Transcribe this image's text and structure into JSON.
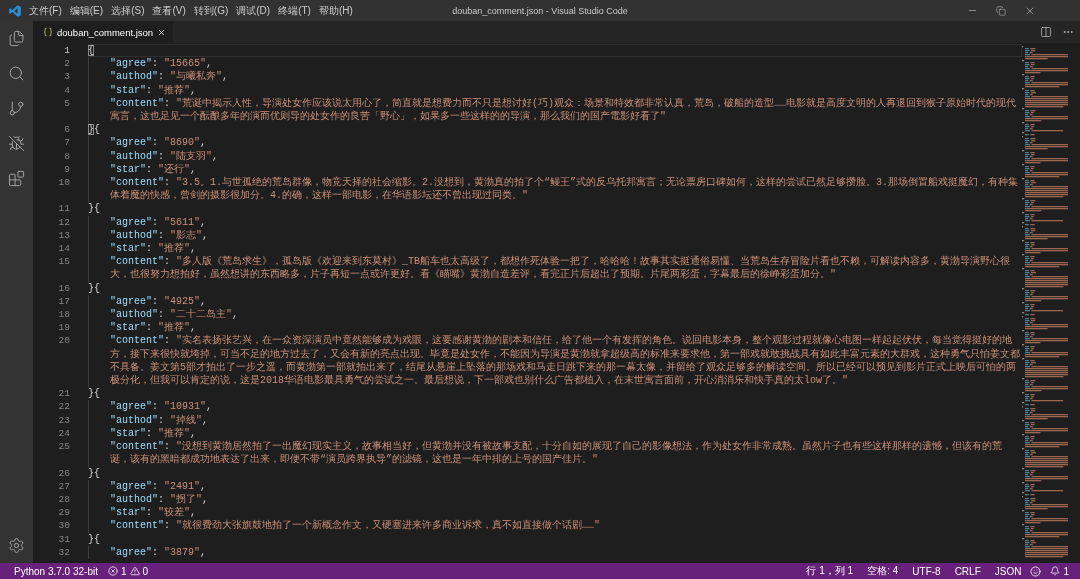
{
  "window": {
    "title": "douban_comment.json - Visual Studio Code"
  },
  "menu": [
    "文件(F)",
    "编辑(E)",
    "选择(S)",
    "查看(V)",
    "转到(G)",
    "调试(D)",
    "终端(T)",
    "帮助(H)"
  ],
  "tabs": [
    {
      "label": "douban_comment.json",
      "selected": true
    }
  ],
  "editor": {
    "lines": [
      {
        "number": "1",
        "kind": "bracket",
        "text": "{",
        "current": true,
        "bracket_match": true
      },
      {
        "number": "2",
        "kind": "field",
        "text": "\"agree\": \"15665\",",
        "current": false,
        "bracket_match": false
      },
      {
        "number": "3",
        "kind": "field",
        "text": "\"authod\": \"与曦私奔\",",
        "current": false,
        "bracket_match": false
      },
      {
        "number": "4",
        "kind": "field",
        "text": "\"star\": \"推荐\",",
        "current": false,
        "bracket_match": false
      },
      {
        "number": "5",
        "kind": "field",
        "text": "\"content\": \"荒诞中揭示人性，导演处女作应该说太用心了，简直就是想费力而不只是想讨好(巧)观众：场景和特效都非常认真，荒岛，破船的造型……电影就是高度文明的人再退回到猴子原始时代的现代寓言，这也足见一个酝酿多年的演而优则导的处女作的良苦「野心」，如果多一些这样的的导演，那么我们的国产電影好看了\"",
        "current": false,
        "bracket_match": false
      },
      {
        "number": "6",
        "kind": "bracket",
        "text": "}{",
        "current": false,
        "bracket_match": true
      },
      {
        "number": "7",
        "kind": "field",
        "text": "\"agree\": \"8690\",",
        "current": false,
        "bracket_match": false
      },
      {
        "number": "8",
        "kind": "field",
        "text": "\"authod\": \"陆支羽\",",
        "current": false,
        "bracket_match": false
      },
      {
        "number": "9",
        "kind": "field",
        "text": "\"star\": \"还行\",",
        "current": false,
        "bracket_match": false
      },
      {
        "number": "10",
        "kind": "field",
        "text": "\"content\": \"3.5。1.与世孤绝的荒岛群像，物竞天择的社会缩影。2.没想到，黄渤真的拍了个“鳗王”式的反乌托邦寓言；无论票房口碑如何，这样的尝试已然足够攒脸。3.那场倒置船戏挺魔幻，有种集体着魔的快感，曾剑的摄影很加分。4.的确，这样一部电影，在华语影坛还不曾出现过同类。\"",
        "current": false,
        "bracket_match": false
      },
      {
        "number": "11",
        "kind": "bracket",
        "text": "}{",
        "current": false,
        "bracket_match": false
      },
      {
        "number": "12",
        "kind": "field",
        "text": "\"agree\": \"5611\",",
        "current": false,
        "bracket_match": false
      },
      {
        "number": "13",
        "kind": "field",
        "text": "\"authod\": \"影志\",",
        "current": false,
        "bracket_match": false
      },
      {
        "number": "14",
        "kind": "field",
        "text": "\"star\": \"推荐\",",
        "current": false,
        "bracket_match": false
      },
      {
        "number": "15",
        "kind": "field",
        "text": "\"content\": \"多人版《荒岛求生》，孤岛版《欢迎来到东莫村》_TB船车也太高级了，都想作死体验一把了，哈哈哈！故事其实挺通俗易懂、当荒岛生存冒险片看也不赖，可解读内容多，黄渤导演野心很大，也很努力想拍好，虽然想讲的东西略多，片子再短一点或许更好。看《瞄嘴》黄渤自造差评，看完正片后超出了预期。片尾两彩蛋，字幕最后的徐峥彩蛋加分。\"",
        "current": false,
        "bracket_match": false
      },
      {
        "number": "16",
        "kind": "bracket",
        "text": "}{",
        "current": false,
        "bracket_match": false
      },
      {
        "number": "17",
        "kind": "field",
        "text": "\"agree\": \"4925\",",
        "current": false,
        "bracket_match": false
      },
      {
        "number": "18",
        "kind": "field",
        "text": "\"authod\": \"二十二岛主\",",
        "current": false,
        "bracket_match": false
      },
      {
        "number": "19",
        "kind": "field",
        "text": "\"star\": \"推荐\",",
        "current": false,
        "bracket_match": false
      },
      {
        "number": "20",
        "kind": "field",
        "text": "\"content\": \"实名表扬张艺兴，在一众资深演员中竟然能够成为戏眼，这要感谢黄渤的剧本和信任，给了他一个有发挥的角色。说回电影本身，整个观影过程就像心电图一样起起伏伏，每当觉得挺好的地方，接下来很快就垮掉，可当不足的地方过去了，又会有新的亮点出现。毕竟是处女作，不能因为导演是黄渤就拿超级高的标准来要求他，第一部戏就敢挑战具有如此丰富元素的大群戏，这种勇气只怕姜文都不具备。姜文第5部才拍出了一步之遥，而黄渤第一部就拍出来了，结尾从悬崖上坠落的那场戏和马走日跳下来的那一幕太像，并留给了观众足够多的解读空间。所以已经可以预见到影片正式上映后可怕的两极分化，但我可以肯定的说，这是2018华语电影最具勇气的尝试之一。最后想说，下一部戏也别什么广告都植入，在末世寓言面前，开心消消乐和快手真的太low了。\"",
        "current": false,
        "bracket_match": false
      },
      {
        "number": "21",
        "kind": "bracket",
        "text": "}{",
        "current": false,
        "bracket_match": false
      },
      {
        "number": "22",
        "kind": "field",
        "text": "\"agree\": \"10931\",",
        "current": false,
        "bracket_match": false
      },
      {
        "number": "23",
        "kind": "field",
        "text": "\"authod\": \"掉线\",",
        "current": false,
        "bracket_match": false
      },
      {
        "number": "24",
        "kind": "field",
        "text": "\"star\": \"推荐\",",
        "current": false,
        "bracket_match": false
      },
      {
        "number": "25",
        "kind": "field",
        "text": "\"content\": \"没想到黄渤居然拍了一出魔幻现实主义，故事相当好，但黄渤并没有被故事支配，十分自如的展现了自己的影像想法，作为处女作非常成熟。虽然片子也有些这样那样的遗憾，但该有的荒诞，该有的黑暗都成功地表达了出来，即便不带“演员跨界执导”的滤镜，这也是一年中排的上号的国产佳片。\"",
        "current": false,
        "bracket_match": false
      },
      {
        "number": "26",
        "kind": "bracket",
        "text": "}{",
        "current": false,
        "bracket_match": false
      },
      {
        "number": "27",
        "kind": "field",
        "text": "\"agree\": \"2491\",",
        "current": false,
        "bracket_match": false
      },
      {
        "number": "28",
        "kind": "field",
        "text": "\"authod\": \"拐了\",",
        "current": false,
        "bracket_match": false
      },
      {
        "number": "29",
        "kind": "field",
        "text": "\"star\": \"较差\",",
        "current": false,
        "bracket_match": false
      },
      {
        "number": "30",
        "kind": "field",
        "text": "\"content\": \"就很费劲大张旗鼓地拍了一个新概念作文，又硬塞进来许多商业诉求，真不如直接做个话剧……\"",
        "current": false,
        "bracket_match": false
      },
      {
        "number": "31",
        "kind": "bracket",
        "text": "}{",
        "current": false,
        "bracket_match": false
      },
      {
        "number": "32",
        "kind": "field",
        "text": "\"agree\": \"3879\",",
        "current": false,
        "bracket_match": false
      }
    ]
  },
  "status_bar": {
    "interpreter": "Python 3.7.0 32-bit",
    "errors": "1",
    "warnings": "0",
    "cursor_position": "行 1，列 1",
    "indentation": "空格: 4",
    "encoding": "UTF-8",
    "line_ending": "CRLF",
    "language": "JSON",
    "notifications": "1"
  }
}
